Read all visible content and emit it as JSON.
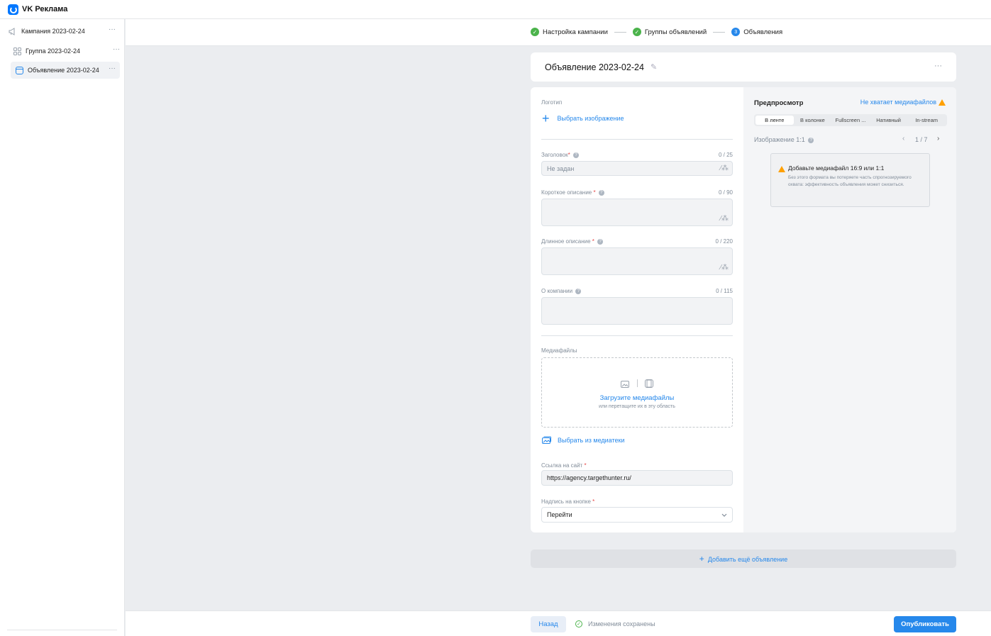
{
  "app": {
    "name": "VK Реклама"
  },
  "sidebar": {
    "items": [
      {
        "label": "Кампания 2023-02-24",
        "icon": "megaphone-icon"
      },
      {
        "label": "Группа 2023-02-24",
        "icon": "grid-icon"
      },
      {
        "label": "Объявление 2023-02-24",
        "icon": "ad-icon"
      }
    ],
    "more": "···"
  },
  "steps": [
    {
      "label": "Настройка кампании",
      "state": "done",
      "mark": "✓"
    },
    {
      "label": "Группы объявлений",
      "state": "done",
      "mark": "✓"
    },
    {
      "label": "Объявления",
      "state": "current",
      "mark": "3"
    }
  ],
  "ad": {
    "title": "Объявление 2023-02-24",
    "more": "···"
  },
  "form": {
    "logo_label": "Логотип",
    "logo_action": "Выбрать изображение",
    "headline": {
      "label": "Заголовок",
      "counter": "0 / 25",
      "placeholder": "Не задан"
    },
    "short_desc": {
      "label": "Короткое описание",
      "counter": "0 / 90"
    },
    "long_desc": {
      "label": "Длинное описание",
      "counter": "0 / 220"
    },
    "about": {
      "label": "О компании",
      "counter": "0 / 115"
    },
    "media": {
      "label": "Медиафайлы",
      "upload_title": "Загрузите медиафайлы",
      "upload_hint": "или перетащите их в эту область",
      "library_link": "Выбрать из медиатеки"
    },
    "site_link": {
      "label": "Ссылка на сайт",
      "value": "https://agency.targethunter.ru/"
    },
    "button_text": {
      "label": "Надпись на кнопке",
      "value": "Перейти"
    },
    "required_mark": "*",
    "help_mark": "?"
  },
  "preview": {
    "title": "Предпросмотр",
    "missing_link": "Не хватает медиафайлов",
    "tabs": [
      "В ленте",
      "В колонке",
      "Fullscreen ...",
      "Нативный",
      "In-stream"
    ],
    "active_tab": 0,
    "image_label": "Изображение 1:1",
    "pager": "1 / 7",
    "warning": {
      "title": "Добавьте медиафайл 16:9 или 1:1",
      "text": "Без этого формата вы потеряете часть спрогнозируемого охвата: эффективность объявления может снизиться."
    }
  },
  "add_ad": "Добавить ещё объявление",
  "footer": {
    "back": "Назад",
    "saved": "Изменения сохранены",
    "publish": "Опубликовать"
  },
  "colors": {
    "accent": "#2688eb",
    "success": "#4bb34b",
    "warning": "#ffa000"
  }
}
